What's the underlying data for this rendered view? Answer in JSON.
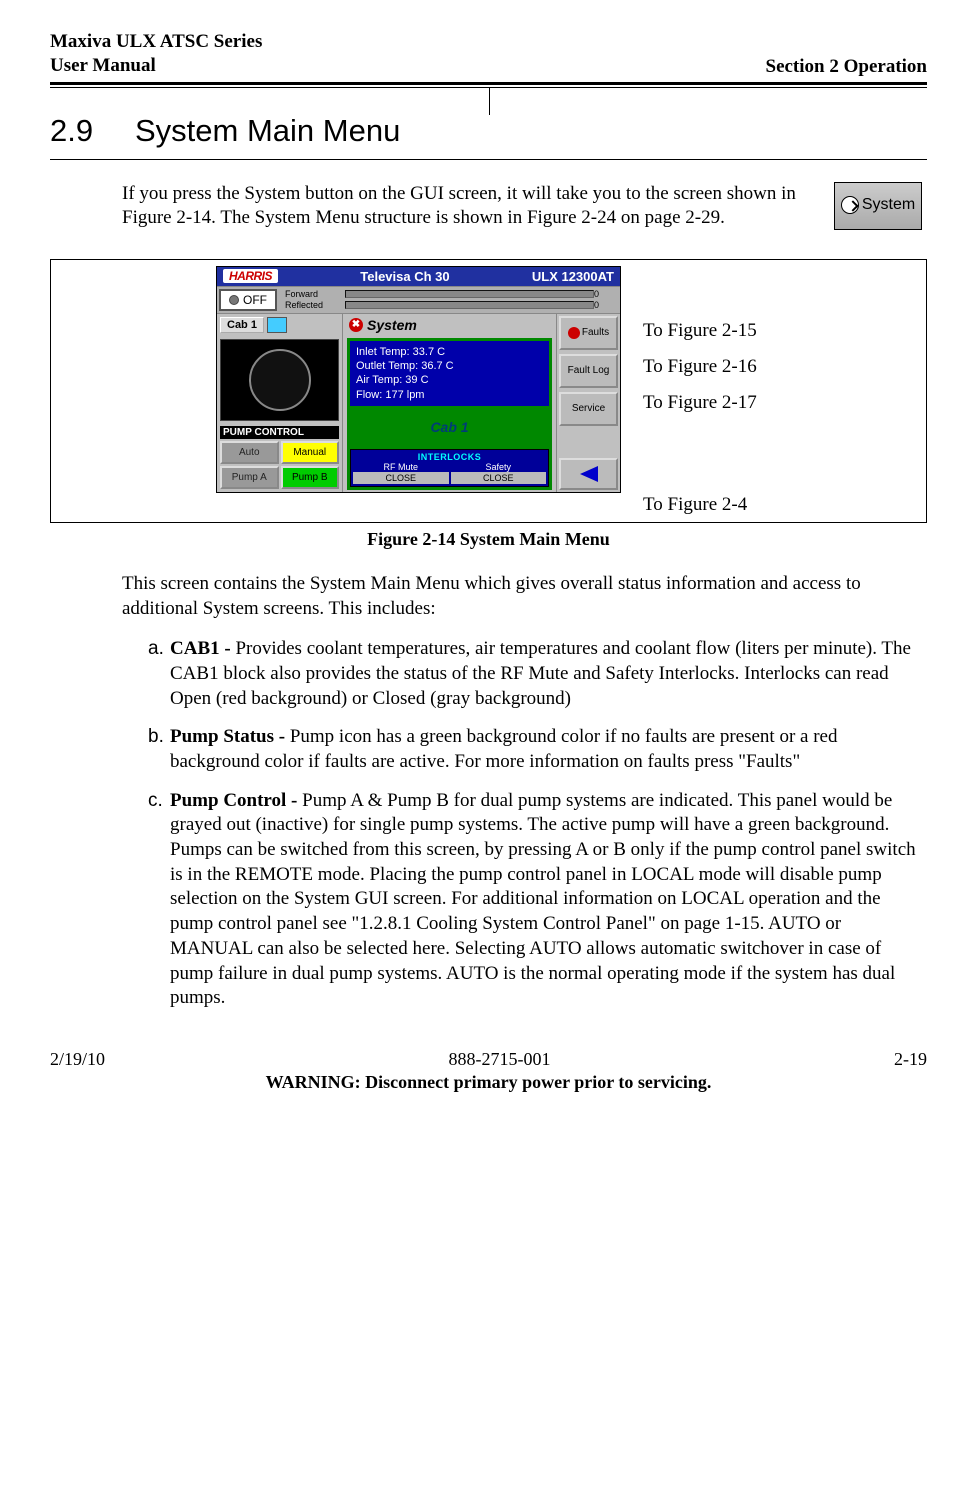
{
  "header": {
    "product_line1": "Maxiva ULX ATSC Series",
    "product_line2": "User Manual",
    "section": "Section 2 Operation"
  },
  "section": {
    "number": "2.9",
    "title": "System Main Menu"
  },
  "intro": "If you press the System button on the GUI screen, it will take you to the screen shown in Figure 2-14. The System Menu structure is shown in Figure 2-24 on page 2-29.",
  "system_button_label": "System",
  "gui": {
    "brand": "HARRIS",
    "channel": "Televisa Ch 30",
    "model": "ULX 12300AT",
    "power": "OFF",
    "forward_label": "Forward",
    "reflected_label": "Reflected",
    "forward_val": "0",
    "reflected_val": "0",
    "cab_tab": "Cab 1",
    "system_label": "System",
    "pump_control_label": "PUMP CONTROL",
    "auto": "Auto",
    "manual": "Manual",
    "pump_a": "Pump A",
    "pump_b": "Pump B",
    "temps": {
      "inlet": "Inlet Temp:    33.7 C",
      "outlet": "Outlet Temp: 36.7 C",
      "air": "Air Temp:       39 C",
      "flow": "Flow:          177 lpm"
    },
    "cab_label": "Cab 1",
    "interlocks_title": "INTERLOCKS",
    "rf_mute_label": "RF Mute",
    "safety_label": "Safety",
    "close": "CLOSE",
    "faults": "Faults",
    "fault_log": "Fault Log",
    "service": "Service"
  },
  "annotations": {
    "a1": "To Figure 2-15",
    "a2": "To Figure 2-16",
    "a3": "To Figure 2-17",
    "a4": "To Figure 2-4"
  },
  "figure_caption": "Figure 2-14  System Main Menu",
  "body_para": "This screen contains the System Main Menu which gives overall status information and access to additional System screens. This includes:",
  "items": {
    "a_marker": "a.",
    "a_bold": "CAB1 - ",
    "a_text": "Provides coolant temperatures, air temperatures and coolant flow (liters per minute). The CAB1 block also provides the status of the RF Mute and Safety Interlocks. Interlocks can read Open (red background) or Closed (gray background)",
    "b_marker": "b.",
    "b_bold": "Pump Status - ",
    "b_text": "Pump icon has a green background color if no faults are present or a red background color if faults are active. For more information on faults press \"Faults\"",
    "c_marker": "c.",
    "c_bold": "Pump Control - ",
    "c_text": "Pump A & Pump B for dual pump systems are indicated. This panel would be grayed out (inactive) for single pump systems. The active pump will have a green background.  Pumps can be switched from this screen, by pressing  A or B only if the pump control panel switch is in the REMOTE mode. Placing the pump control panel in LOCAL mode will disable pump selection on the System GUI screen. For additional information on LOCAL operation and the pump control panel see \"1.2.8.1 Cooling System Control Panel\" on page 1-15. AUTO or MANUAL can also be selected here. Selecting AUTO allows automatic switchover in case of pump failure in dual pump systems. AUTO is the normal operating mode if the system has dual pumps."
  },
  "footer": {
    "date": "2/19/10",
    "docnum": "888-2715-001",
    "page": "2-19",
    "warning": "WARNING: Disconnect primary power prior to servicing."
  }
}
